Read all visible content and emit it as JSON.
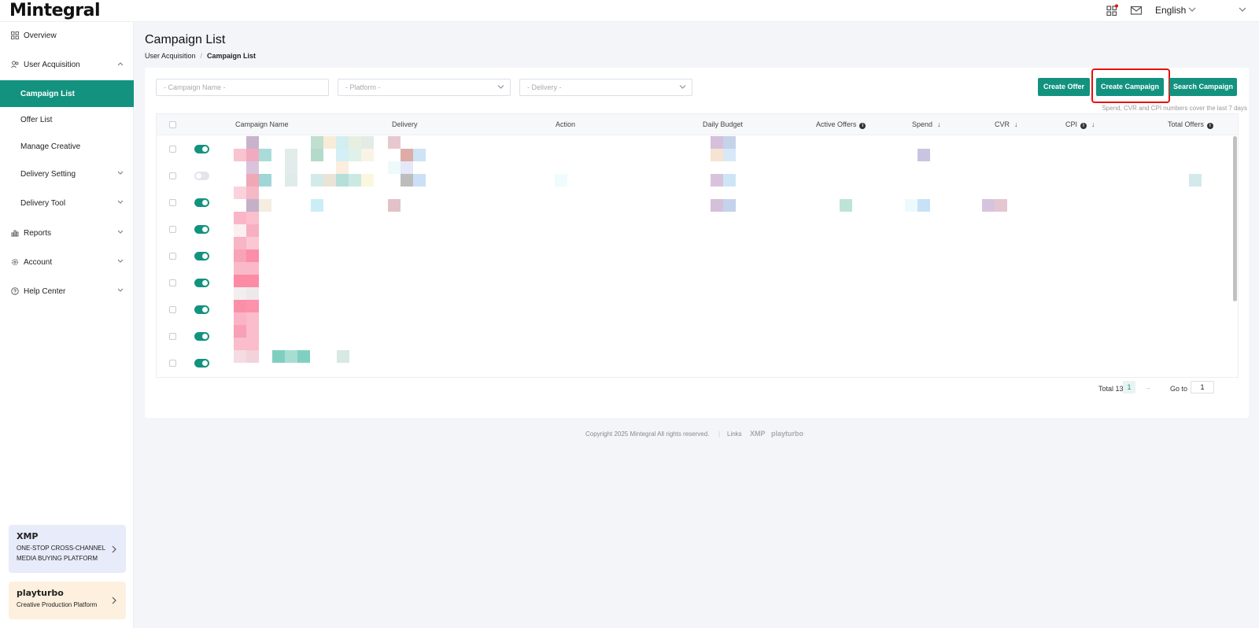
{
  "brand": {
    "logo": "Mintegral"
  },
  "header": {
    "language": "English",
    "accent": "#13937f"
  },
  "sidebar": {
    "items": [
      {
        "label": "Overview",
        "icon": "grid-icon"
      },
      {
        "label": "User Acquisition",
        "icon": "users-icon"
      },
      {
        "label": "Campaign List"
      },
      {
        "label": "Offer List"
      },
      {
        "label": "Manage Creative"
      },
      {
        "label": "Delivery Setting"
      },
      {
        "label": "Delivery Tool"
      },
      {
        "label": "Reports",
        "icon": "chart-icon"
      },
      {
        "label": "Account",
        "icon": "gear-icon"
      },
      {
        "label": "Help Center",
        "icon": "help-icon"
      }
    ],
    "promos": [
      {
        "title": "XMP",
        "text": "ONE-STOP CROSS-CHANNEL MEDIA BUYING PLATFORM"
      },
      {
        "title": "playturbo",
        "text": "Creative Production Platform"
      }
    ]
  },
  "page": {
    "title": "Campaign List",
    "breadcrumb": [
      "User Acquisition",
      "Campaign List"
    ]
  },
  "filters": {
    "campaign_name": "- Campaign Name -",
    "platform": "- Platform -",
    "delivery": "- Delivery -"
  },
  "buttons": {
    "create_offer": "Create Offer",
    "create_campaign": "Create Campaign",
    "search_campaign": "Search Campaign"
  },
  "note": "Spend, CVR and CPI numbers cover the last 7 days",
  "table": {
    "columns": [
      "Campaign Name",
      "Delivery",
      "Action",
      "Daily Budget",
      "Active Offers",
      "Spend",
      "CVR",
      "CPI",
      "Total Offers"
    ],
    "rows": [
      {
        "on": true
      },
      {
        "on": false
      },
      {
        "on": true
      },
      {
        "on": true
      },
      {
        "on": true
      },
      {
        "on": true
      },
      {
        "on": true
      },
      {
        "on": true
      },
      {
        "on": true
      }
    ]
  },
  "pagination": {
    "total": "Total 13",
    "current": "1",
    "goto_label": "Go to",
    "goto_value": "1"
  },
  "footer": {
    "copyright": "Copyright 2025 Mintegral All rights reserved.",
    "links_label": "Links",
    "link1": "XMP",
    "link2": "playturbo"
  }
}
